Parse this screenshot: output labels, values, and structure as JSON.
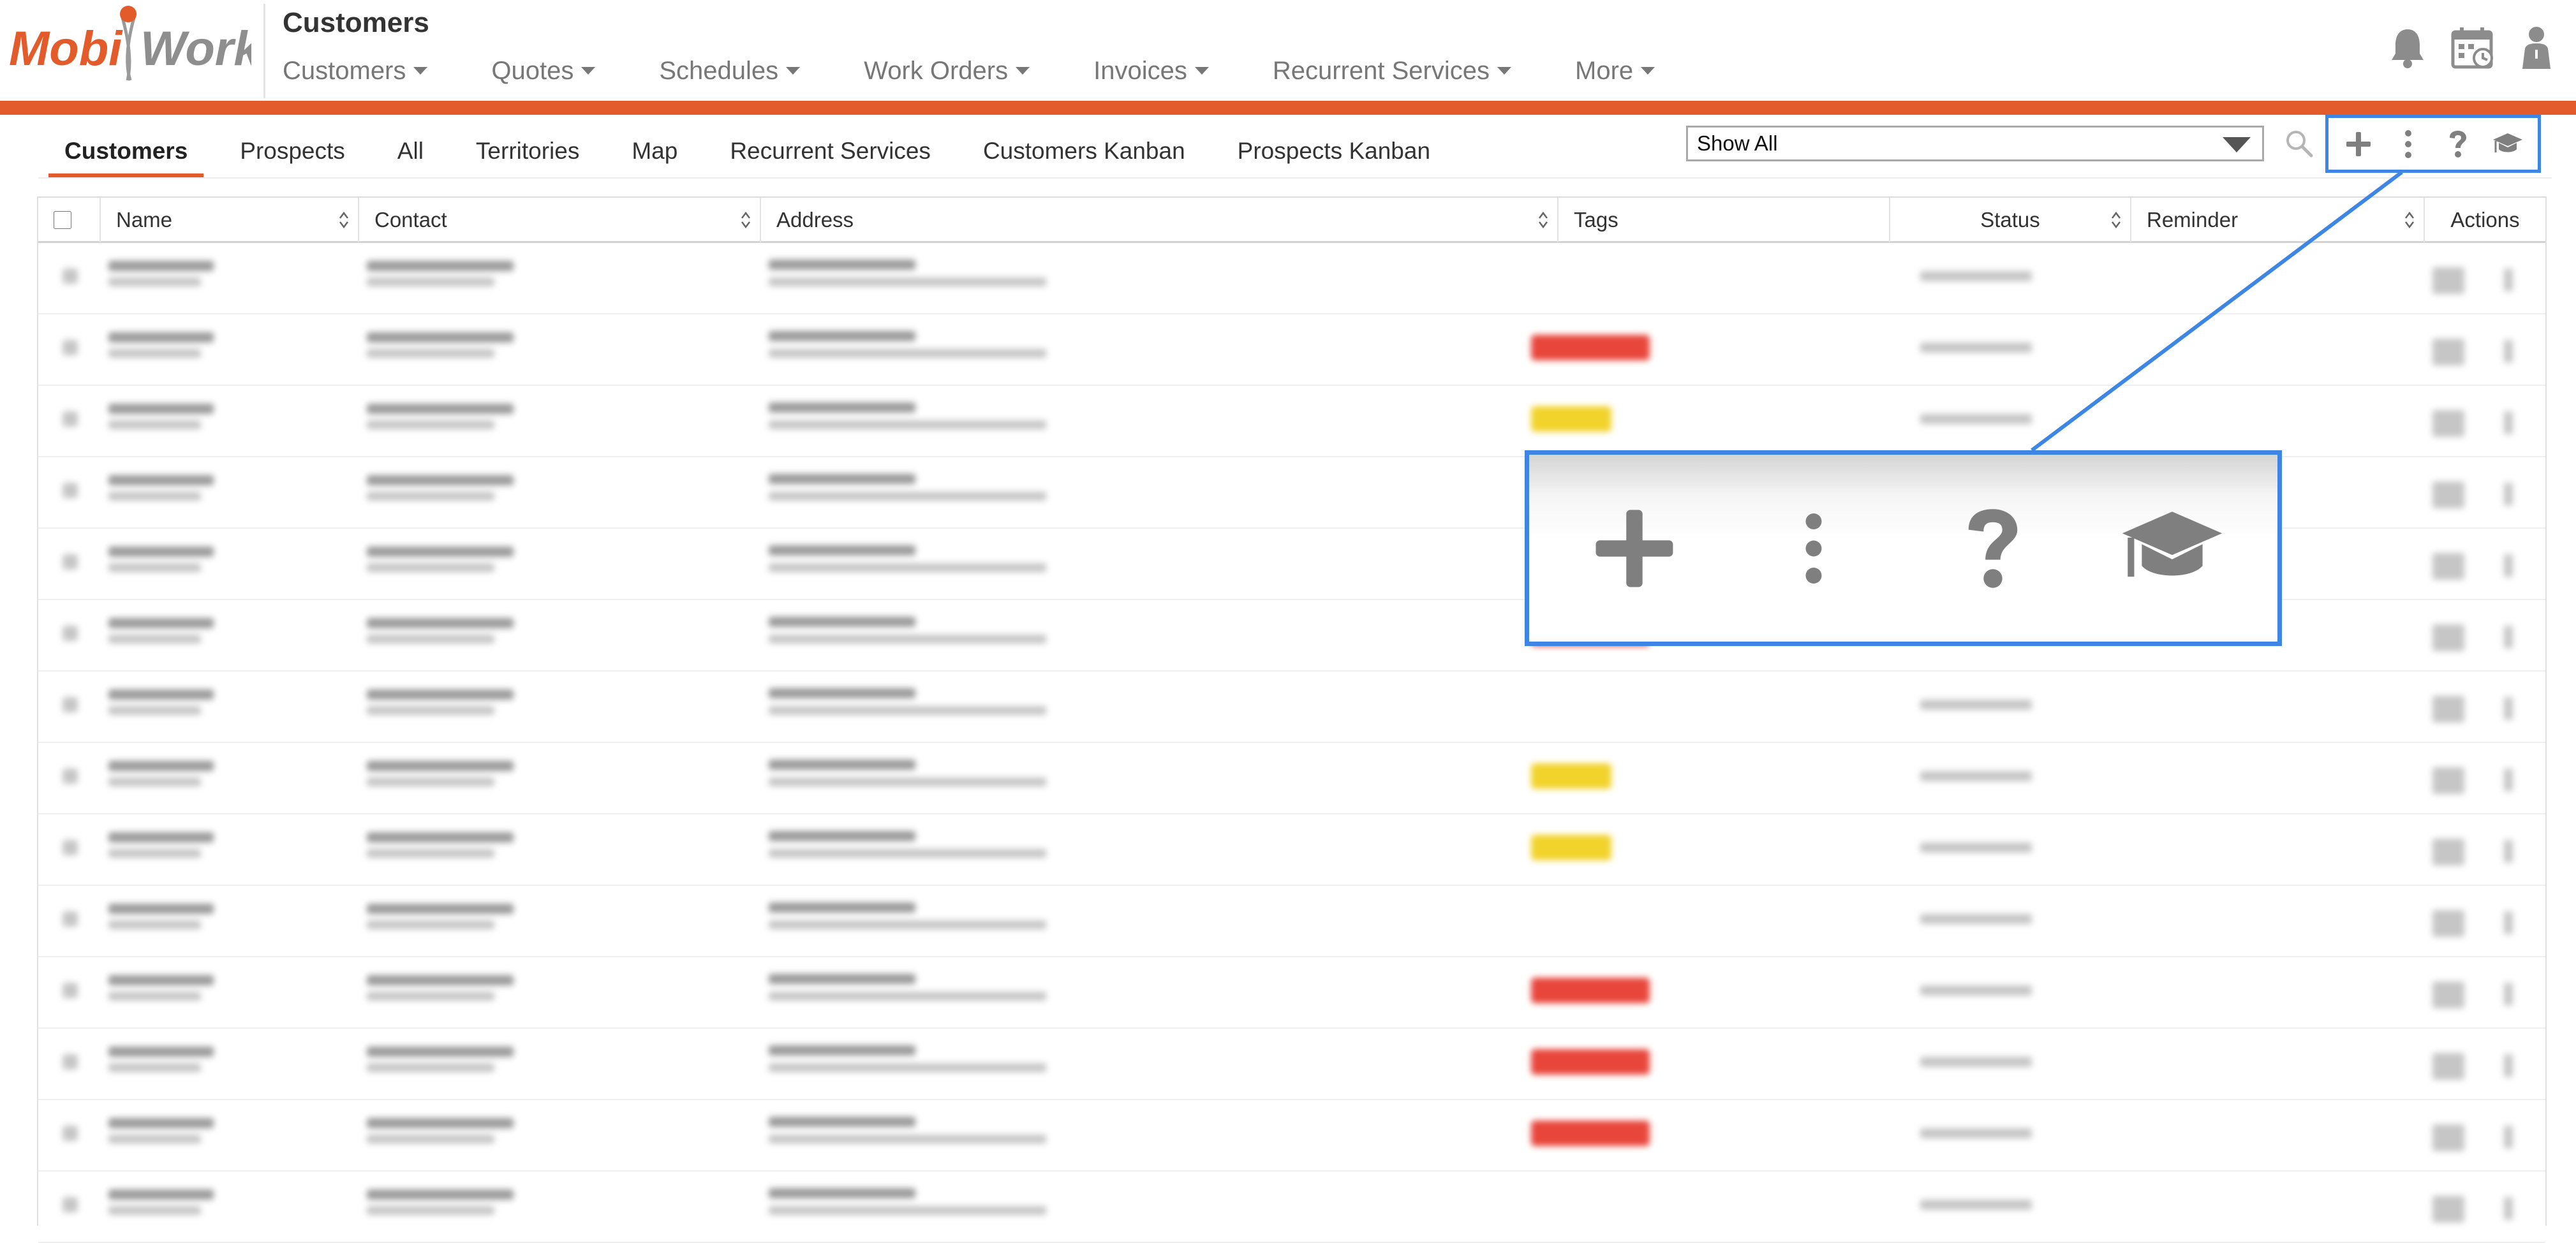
{
  "app": {
    "logo_text_left": "Mobi",
    "logo_text_right": "Work",
    "title": "Customers",
    "brand_color": "#e35b2b",
    "highlight_color": "#3d86e6"
  },
  "main_nav": [
    {
      "label": "Customers"
    },
    {
      "label": "Quotes"
    },
    {
      "label": "Schedules"
    },
    {
      "label": "Work Orders"
    },
    {
      "label": "Invoices"
    },
    {
      "label": "Recurrent Services"
    },
    {
      "label": "More"
    }
  ],
  "header_icons": [
    "bell-icon",
    "calendar-icon",
    "user-icon"
  ],
  "sub_nav": {
    "tabs": [
      {
        "label": "Customers",
        "active": true
      },
      {
        "label": "Prospects"
      },
      {
        "label": "All"
      },
      {
        "label": "Territories"
      },
      {
        "label": "Map"
      },
      {
        "label": "Recurrent Services"
      },
      {
        "label": "Customers Kanban"
      },
      {
        "label": "Prospects Kanban"
      }
    ]
  },
  "filter": {
    "selected": "Show All"
  },
  "toolbar": {
    "icons": [
      "plus-icon",
      "more-vertical-icon",
      "help-icon",
      "graduation-cap-icon"
    ]
  },
  "table": {
    "columns": [
      {
        "label": "Name"
      },
      {
        "label": "Contact"
      },
      {
        "label": "Address"
      },
      {
        "label": "Tags"
      },
      {
        "label": "Status"
      },
      {
        "label": "Reminder"
      },
      {
        "label": "Actions"
      }
    ],
    "rows": [
      {
        "tag": ""
      },
      {
        "tag": "red"
      },
      {
        "tag": "yellow"
      },
      {
        "tag": ""
      },
      {
        "tag": ""
      },
      {
        "tag": "red"
      },
      {
        "tag": ""
      },
      {
        "tag": "yellow"
      },
      {
        "tag": "yellow"
      },
      {
        "tag": ""
      },
      {
        "tag": "red"
      },
      {
        "tag": "red"
      },
      {
        "tag": "red"
      },
      {
        "tag": ""
      }
    ]
  }
}
